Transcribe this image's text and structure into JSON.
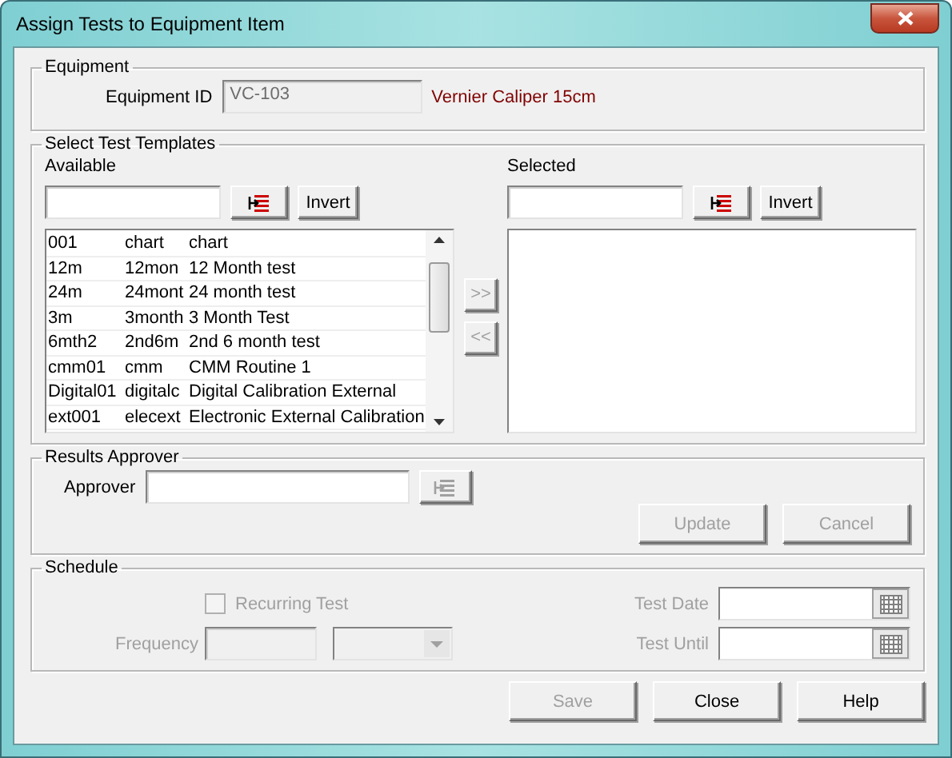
{
  "window": {
    "title": "Assign Tests to Equipment Item"
  },
  "equipment": {
    "legend": "Equipment",
    "id_label": "Equipment ID",
    "id_value": "VC-103",
    "description": "Vernier Caliper 15cm"
  },
  "templates": {
    "legend": "Select Test Templates",
    "available": {
      "label": "Available",
      "invert": "Invert",
      "rows": [
        {
          "cells": [
            "001",
            "chart",
            "chart"
          ]
        },
        {
          "cells": [
            "12m",
            "12mon",
            "12 Month test"
          ]
        },
        {
          "cells": [
            "24m",
            "24mont",
            "24 month test"
          ]
        },
        {
          "cells": [
            "3m",
            "3month",
            "3 Month Test"
          ]
        },
        {
          "cells": [
            "6mth2",
            "2nd6m",
            "2nd 6 month test"
          ]
        },
        {
          "cells": [
            "cmm01",
            "cmm",
            "CMM Routine 1"
          ]
        },
        {
          "cells": [
            "Digital01",
            "digitalc",
            "Digital Calibration External"
          ]
        },
        {
          "cells": [
            "ext001",
            "elecext",
            "Electronic External Calibration"
          ]
        }
      ]
    },
    "move_buttons": [
      {
        "label": ">>",
        "disabled": true
      },
      {
        "label": "<<",
        "disabled": true
      }
    ],
    "selected": {
      "label": "Selected",
      "invert": "Invert"
    }
  },
  "approver": {
    "legend": "Results Approver",
    "label": "Approver",
    "buttons": [
      {
        "label": "Update",
        "disabled": true
      },
      {
        "label": "Cancel",
        "disabled": true
      }
    ]
  },
  "schedule": {
    "legend": "Schedule",
    "disabled": true,
    "recurring": {
      "label": "Recurring Test",
      "checked": false
    },
    "frequency_label": "Frequency",
    "test_date_label": "Test Date",
    "test_until_label": "Test Until"
  },
  "buttons": [
    {
      "label": "Save",
      "disabled": true
    },
    {
      "label": "Close",
      "disabled": false
    },
    {
      "label": "Help",
      "disabled": false
    }
  ]
}
